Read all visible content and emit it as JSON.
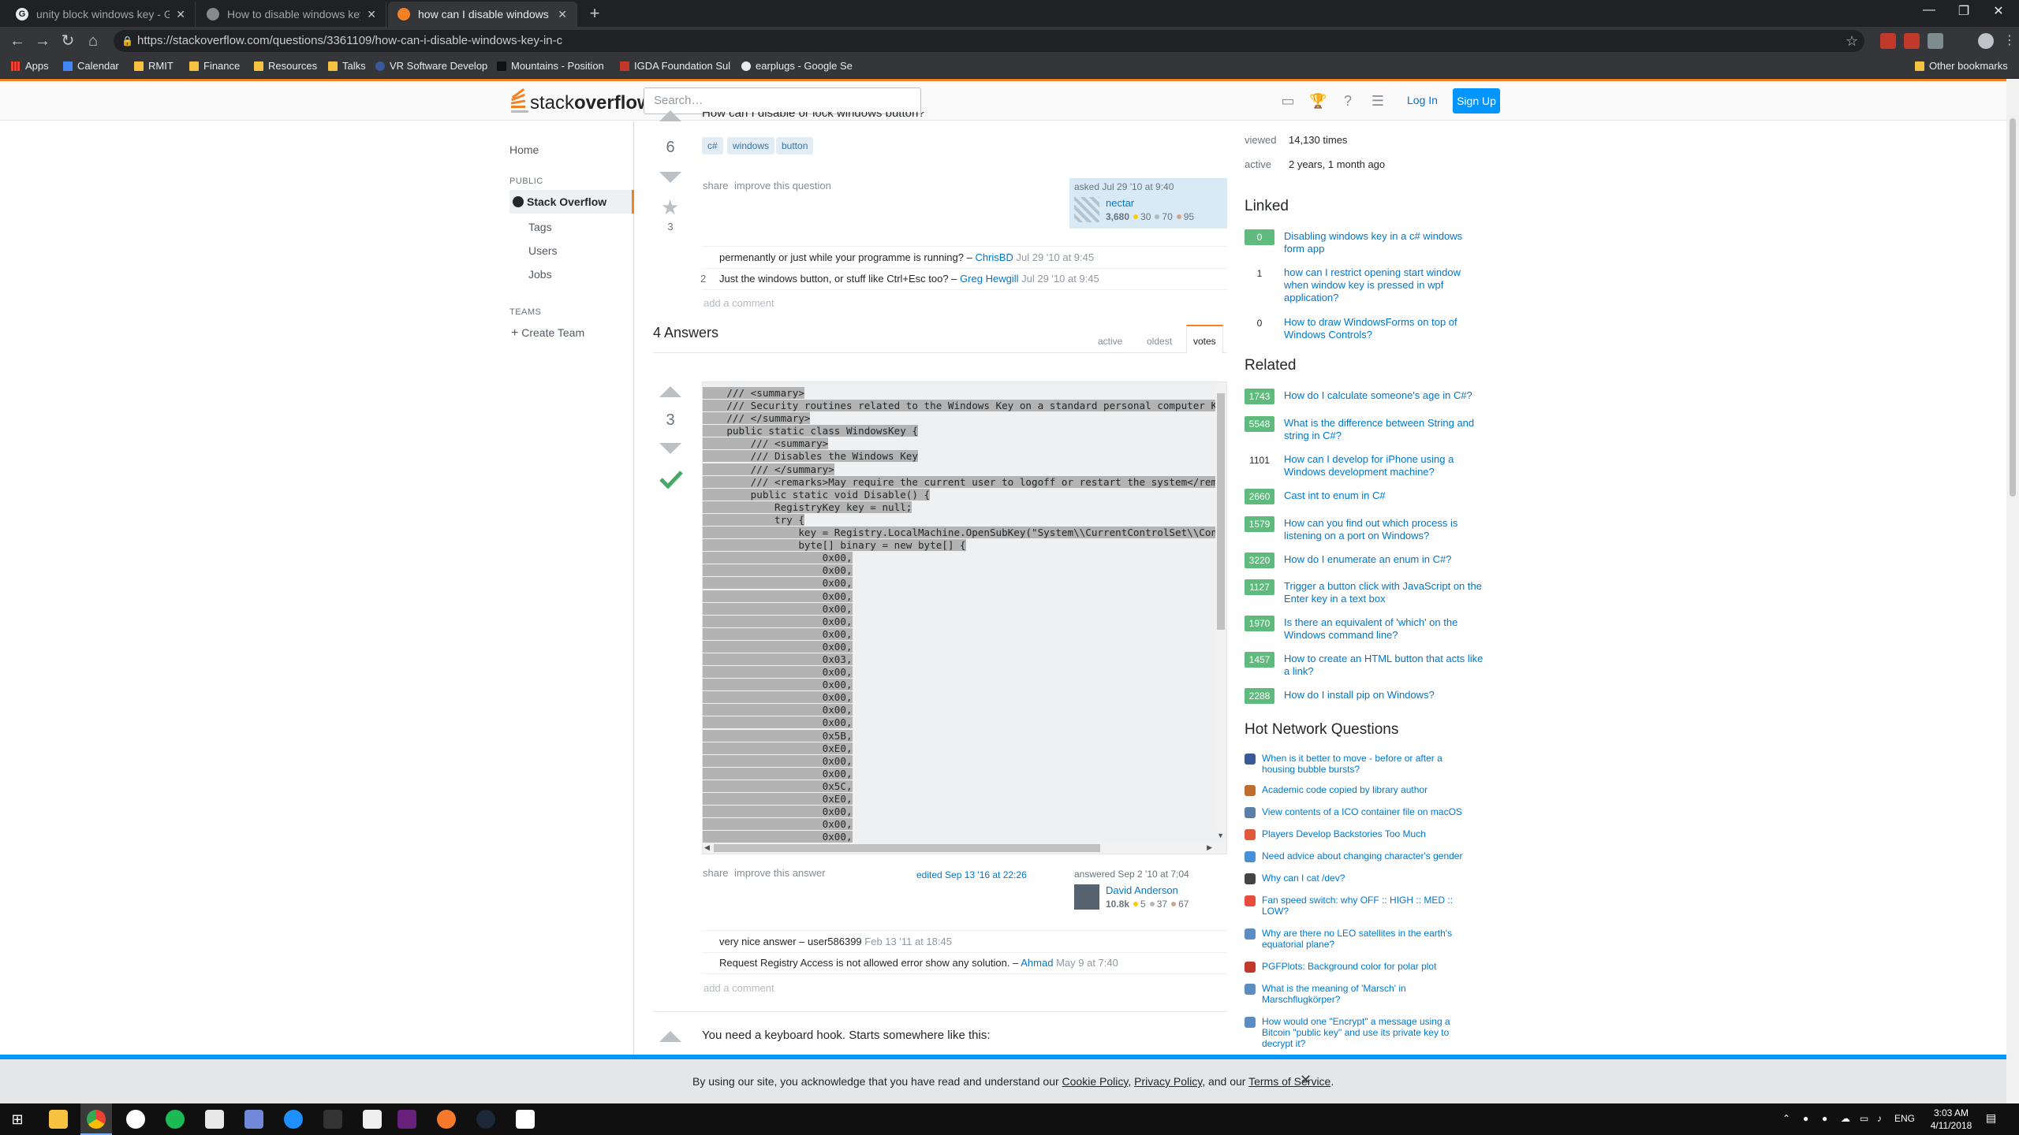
{
  "browser": {
    "tabs": [
      {
        "title": "unity block windows key - Google",
        "favicon": "G"
      },
      {
        "title": "How to disable windows key? - U",
        "favicon": ""
      },
      {
        "title": "how can I disable windows key in",
        "favicon": ""
      }
    ],
    "url": "https://stackoverflow.com/questions/3361109/how-can-i-disable-windows-key-in-c",
    "bookmarks": [
      "Apps",
      "Calendar",
      "RMIT",
      "Finance",
      "Resources",
      "Talks",
      "VR Software Develop",
      "Mountains - Position",
      "IGDA Foundation Sul",
      "earplugs - Google Se"
    ],
    "other_bookmarks": "Other bookmarks"
  },
  "so": {
    "logo_left": "stack",
    "logo_right": "overflow",
    "search_placeholder": "Search…",
    "login": "Log In",
    "signup": "Sign Up",
    "accent": "#f48024"
  },
  "leftnav": {
    "home": "Home",
    "public": "PUBLIC",
    "stack_overflow": "Stack Overflow",
    "tags": "Tags",
    "users": "Users",
    "jobs": "Jobs",
    "teams": "TEAMS",
    "create_team": "Create Team"
  },
  "question": {
    "title_fragment": "How can I disable or lock windows button?",
    "votes": "6",
    "favorites": "3",
    "tags": [
      "c#",
      "windows",
      "button"
    ],
    "share": "share",
    "improve": "improve this question",
    "asked": "asked Jul 29 '10 at 9:40",
    "user": "nectar",
    "rep": "3,680",
    "gold": "30",
    "silver": "70",
    "bronze": "95",
    "comments": [
      {
        "score": "",
        "text": "permenantly or just while your programme is running? –",
        "user": "ChrisBD",
        "date": "Jul 29 '10 at 9:45"
      },
      {
        "score": "2",
        "text": "Just the windows button, or stuff like Ctrl+Esc too? –",
        "user": "Greg Hewgill",
        "date": "Jul 29 '10 at 9:45"
      }
    ],
    "add_comment": "add a comment"
  },
  "answers": {
    "count_label": "4 Answers",
    "sort": {
      "active": "active",
      "oldest": "oldest",
      "votes": "votes"
    }
  },
  "answer1": {
    "votes": "3",
    "code": "    /// <summary>\n    /// Security routines related to the Windows Key on a standard personal computer Keyboard\n    /// </summary>\n    public static class WindowsKey {\n        /// <summary>\n        /// Disables the Windows Key\n        /// </summary>\n        /// <remarks>May require the current user to logoff or restart the system</remarks>\n        public static void Disable() {\n            RegistryKey key = null;\n            try {\n                key = Registry.LocalMachine.OpenSubKey(\"System\\\\CurrentControlSet\\\\Control\n                byte[] binary = new byte[] {\n                    0x00,\n                    0x00,\n                    0x00,\n                    0x00,\n                    0x00,\n                    0x00,\n                    0x00,\n                    0x00,\n                    0x03,\n                    0x00,\n                    0x00,\n                    0x00,\n                    0x00,\n                    0x00,\n                    0x5B,\n                    0xE0,\n                    0x00,\n                    0x00,\n                    0x5C,\n                    0xE0,\n                    0x00,\n                    0x00,\n                    0x00,",
    "share": "share",
    "improve": "improve this answer",
    "edited": "edited Sep 13 '16 at 22:26",
    "answered": "answered Sep 2 '10 at 7:04",
    "user": "David Anderson",
    "rep": "10.8k",
    "gold": "5",
    "silver": "37",
    "bronze": "67",
    "comments": [
      {
        "score": "",
        "text": "very nice answer – user586399",
        "user": "",
        "date": "Feb 13 '11 at 18:45"
      },
      {
        "score": "",
        "text": "Request Registry Access is not allowed error show any solution. –",
        "user": "Ahmad",
        "date": "May 9 at 7:40"
      }
    ],
    "add_comment": "add a comment"
  },
  "answer2": {
    "preview": "You need a keyboard hook. Starts somewhere like this:"
  },
  "sidebar": {
    "viewed_label": "viewed",
    "viewed_value": "14,130 times",
    "active_label": "active",
    "active_value": "2 years, 1 month ago",
    "linked_title": "Linked",
    "linked": [
      {
        "count": "0",
        "text": "Disabling windows key in a c# windows form app",
        "green": true
      },
      {
        "count": "1",
        "text": "how can I restrict opening start window when window key is pressed in wpf application?",
        "green": false
      },
      {
        "count": "0",
        "text": "How to draw WindowsForms on top of Windows Controls?",
        "green": false
      }
    ],
    "related_title": "Related",
    "related": [
      {
        "count": "1743",
        "text": "How do I calculate someone's age in C#?",
        "green": true
      },
      {
        "count": "5548",
        "text": "What is the difference between String and string in C#?",
        "green": true
      },
      {
        "count": "1101",
        "text": "How can I develop for iPhone using a Windows development machine?",
        "green": false
      },
      {
        "count": "2660",
        "text": "Cast int to enum in C#",
        "green": true
      },
      {
        "count": "1579",
        "text": "How can you find out which process is listening on a port on Windows?",
        "green": true
      },
      {
        "count": "3220",
        "text": "How do I enumerate an enum in C#?",
        "green": true
      },
      {
        "count": "1127",
        "text": "Trigger a button click with JavaScript on the Enter key in a text box",
        "green": true
      },
      {
        "count": "1970",
        "text": "Is there an equivalent of 'which' on the Windows command line?",
        "green": true
      },
      {
        "count": "1457",
        "text": "How to create an HTML button that acts like a link?",
        "green": true
      },
      {
        "count": "2288",
        "text": "How do I install pip on Windows?",
        "green": true
      }
    ],
    "hnq_title": "Hot Network Questions",
    "hnq": [
      "When is it better to move - before or after a housing bubble bursts?",
      "Academic code copied by library author",
      "View contents of a ICO container file on macOS",
      "Players Develop Backstories Too Much",
      "Need advice about changing character's gender",
      "Why can I cat /dev?",
      "Fan speed switch: why OFF :: HIGH :: MED :: LOW?",
      "Why are there no LEO satellites in the earth's equatorial plane?",
      "PGFPlots: Background color for polar plot",
      "What is the meaning of 'Marsch' in Marschflugkörper?",
      "How would one \"Encrypt\" a message using a Bitcoin \"public key\" and use its private key to decrypt it?"
    ]
  },
  "cookie": {
    "prefix": "By using our site, you acknowledge that you have read and understand our",
    "cookie_policy": "Cookie Policy",
    "privacy_policy": "Privacy Policy",
    "and_our": ", and our",
    "terms": "Terms of Service",
    "close": "✕"
  },
  "taskbar": {
    "lang": "ENG",
    "time": "3:03 AM",
    "date": "4/11/2018"
  }
}
